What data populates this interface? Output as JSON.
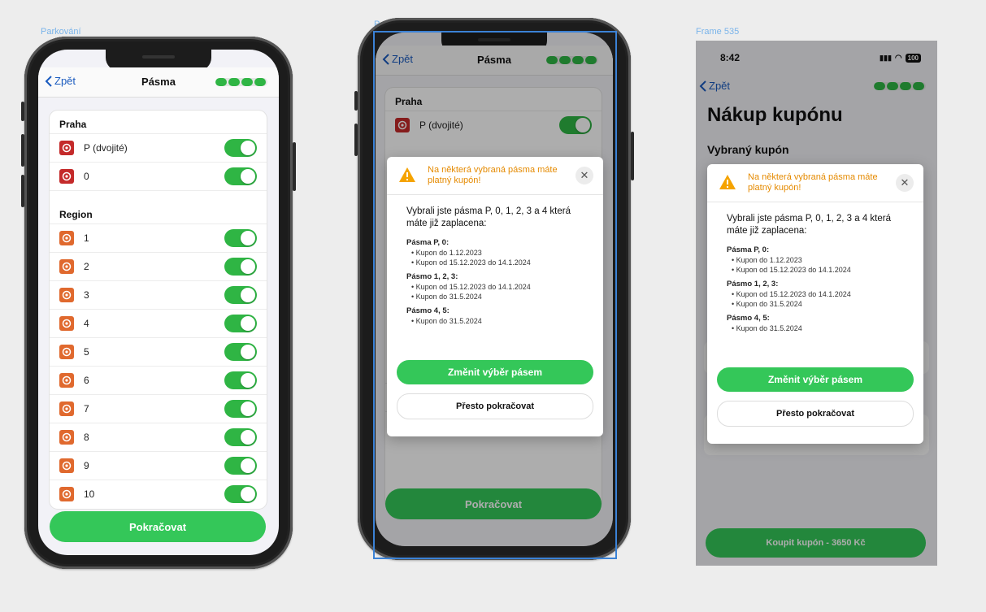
{
  "frames": {
    "left_label": "Parkování",
    "middle_label": "Parkování",
    "right_label": "Frame 535"
  },
  "nav": {
    "back_label": "Zpět",
    "title": "Pásma",
    "progress_steps": 4,
    "progress_filled": 4
  },
  "zones": {
    "praha_header": "Praha",
    "region_header": "Region",
    "praha_items": [
      {
        "label": "P (dvojité)",
        "on": true,
        "color": "#c42a2a"
      },
      {
        "label": "0",
        "on": true,
        "color": "#c42a2a"
      }
    ],
    "region_items": [
      {
        "label": "1",
        "on": true
      },
      {
        "label": "2",
        "on": true
      },
      {
        "label": "3",
        "on": true
      },
      {
        "label": "4",
        "on": true
      },
      {
        "label": "5",
        "on": true
      },
      {
        "label": "6",
        "on": true
      },
      {
        "label": "7",
        "on": true
      },
      {
        "label": "8",
        "on": true
      },
      {
        "label": "9",
        "on": true
      },
      {
        "label": "10",
        "on": true
      }
    ],
    "region_color": "#e0692e"
  },
  "continue_button": "Pokračovat",
  "dialog": {
    "warning": "Na některá vybraná pásma máte platný kupón!",
    "close_icon": "close-icon",
    "intro": "Vybrali jste pásma P, 0, 1, 2, 3 a 4 která máte již zaplacena:",
    "groups": [
      {
        "title": "Pásma P, 0:",
        "items": [
          "Kupon do 1.12.2023",
          "Kupon od 15.12.2023 do 14.1.2024"
        ]
      },
      {
        "title": "Pásmo 1, 2, 3:",
        "items": [
          "Kupon od 15.12.2023 do 14.1.2024",
          "Kupon do 31.5.2024"
        ]
      },
      {
        "title": "Pásmo 4, 5:",
        "items": [
          "Kupon do 31.5.2024"
        ]
      }
    ],
    "primary_button": "Změnit výběr pásem",
    "secondary_button": "Přesto pokračovat"
  },
  "purchase": {
    "time": "8:42",
    "battery": "100",
    "back_label": "Zpět",
    "title": "Nákup kupónu",
    "subtitle": "Vybraný kupón",
    "buy_button": "Koupit kupón - 3650 Kč"
  },
  "colors": {
    "accent_green": "#34c759",
    "warning_orange": "#e58a00",
    "link_blue": "#1a5bbf",
    "selection_blue": "#3b82d6"
  }
}
